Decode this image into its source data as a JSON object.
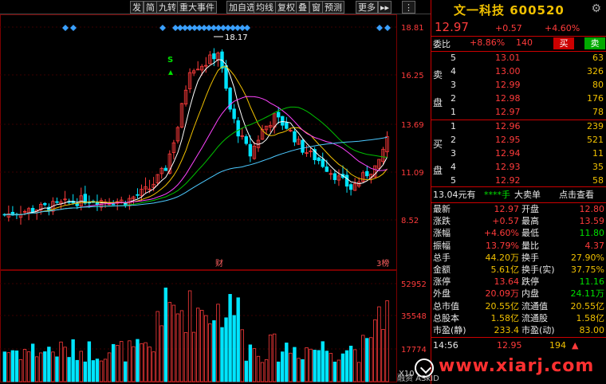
{
  "toolbar": {
    "items": [
      "发",
      "简",
      "九转",
      "重大事件",
      "加自选",
      "均线",
      "复权",
      "叠",
      "窗",
      "预测",
      "更多"
    ],
    "arrow_icon": "double-arrow-icon"
  },
  "chart": {
    "price_ticks": [
      "18.81",
      "16.25",
      "13.69",
      "11.09",
      "8.52"
    ],
    "volume_ticks": [
      "52952",
      "35548",
      "17774"
    ],
    "volume_unit": "X10",
    "max_label": "18.17",
    "s_marker": "S",
    "event_label_1": "财",
    "event_label_2": "3榜",
    "colors": {
      "up": "#ff3b3b",
      "down": "#00e5ff",
      "ma1": "#ffffff",
      "ma2": "#f0c000",
      "ma3": "#ff44ff",
      "ma4": "#00c000",
      "ma5": "#4cc9ff",
      "diamond": "#3aa0ff"
    }
  },
  "quote": {
    "name": "文一科技",
    "code": "600520",
    "price": "12.97",
    "change": "+0.57",
    "pct": "+4.60%",
    "weibi_label": "委比",
    "weibi": "+8.86%",
    "weicha": "140",
    "buy_btn": "买",
    "sell_btn": "卖",
    "sell_side_label": [
      "卖",
      "盘"
    ],
    "buy_side_label": [
      "买",
      "盘"
    ],
    "asks": [
      {
        "level": "5",
        "price": "13.01",
        "vol": "63"
      },
      {
        "level": "4",
        "price": "13.00",
        "vol": "326"
      },
      {
        "level": "3",
        "price": "12.99",
        "vol": "80"
      },
      {
        "level": "2",
        "price": "12.98",
        "vol": "176"
      },
      {
        "level": "1",
        "price": "12.97",
        "vol": "78"
      }
    ],
    "bids": [
      {
        "level": "1",
        "price": "12.96",
        "vol": "239"
      },
      {
        "level": "2",
        "price": "12.95",
        "vol": "521"
      },
      {
        "level": "3",
        "price": "12.94",
        "vol": "11"
      },
      {
        "level": "4",
        "price": "12.93",
        "vol": "35"
      },
      {
        "level": "5",
        "price": "12.92",
        "vol": "58"
      }
    ],
    "sub_left": "13.04元有",
    "sub_stars": "****手",
    "sub_mid": "大卖单",
    "sub_right": "点击查看",
    "stats": [
      {
        "l1": "最新",
        "v1": "12.97",
        "c1": "red",
        "l2": "开盘",
        "v2": "12.80",
        "c2": "red"
      },
      {
        "l1": "涨跌",
        "v1": "+0.57",
        "c1": "red",
        "l2": "最高",
        "v2": "13.59",
        "c2": "red"
      },
      {
        "l1": "涨幅",
        "v1": "+4.60%",
        "c1": "red",
        "l2": "最低",
        "v2": "11.80",
        "c2": "green"
      },
      {
        "l1": "振幅",
        "v1": "13.79%",
        "c1": "red",
        "l2": "量比",
        "v2": "4.37",
        "c2": "red"
      },
      {
        "l1": "总手",
        "v1": "44.20万",
        "c1": "yellow",
        "l2": "换手",
        "v2": "27.90%",
        "c2": "yellow"
      },
      {
        "l1": "金额",
        "v1": "5.61亿",
        "c1": "yellow",
        "l2": "换手(实)",
        "v2": "37.75%",
        "c2": "yellow"
      },
      {
        "l1": "涨停",
        "v1": "13.64",
        "c1": "red",
        "l2": "跌停",
        "v2": "11.16",
        "c2": "green"
      },
      {
        "l1": "外盘",
        "v1": "20.09万",
        "c1": "red",
        "l2": "内盘",
        "v2": "24.11万",
        "c2": "green"
      },
      {
        "l1": "总市值",
        "v1": "20.55亿",
        "c1": "yellow",
        "l2": "流通值",
        "v2": "20.55亿",
        "c2": "yellow"
      },
      {
        "l1": "总股本",
        "v1": "1.58亿",
        "c1": "yellow",
        "l2": "流通股",
        "v2": "1.58亿",
        "c2": "yellow"
      },
      {
        "l1": "市盈(静)",
        "v1": "233.4",
        "c1": "yellow",
        "l2": "市盈(动)",
        "v2": "83.00",
        "c2": "yellow"
      }
    ],
    "tick": {
      "time": "14:56",
      "price": "12.95",
      "vol": "194"
    },
    "watermark": "www.xiarj.com",
    "corner_text": "融资 ASkID"
  }
}
